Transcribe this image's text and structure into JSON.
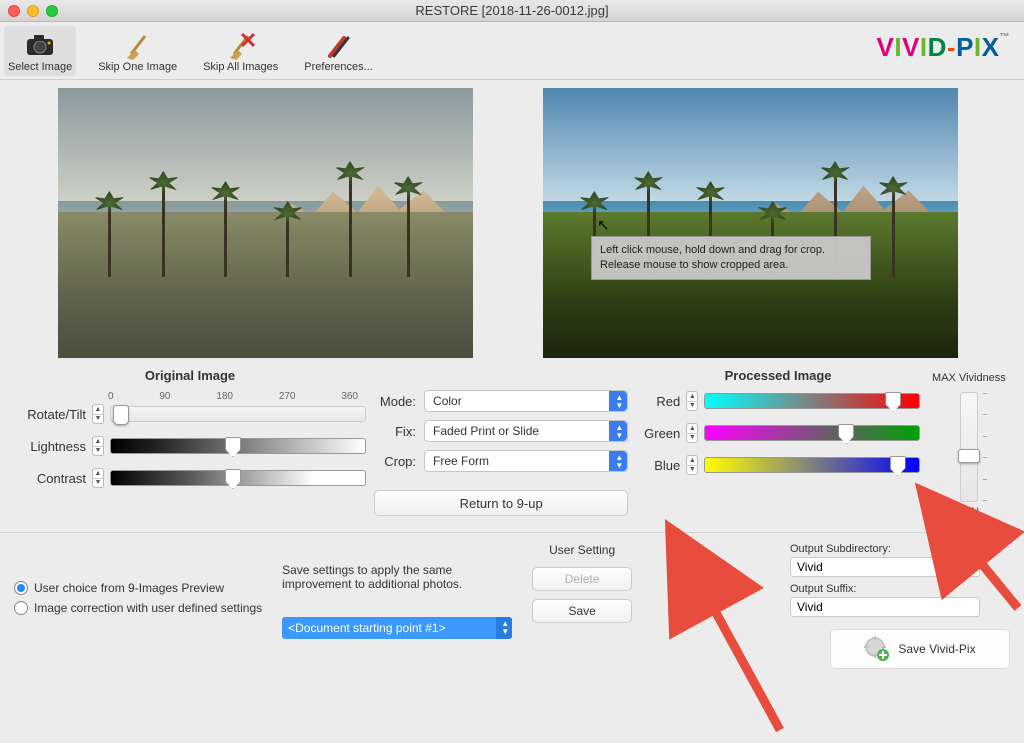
{
  "window_title": "RESTORE [2018-11-26-0012.jpg]",
  "toolbar": {
    "select": "Select Image",
    "skip_one": "Skip One Image",
    "skip_all": "Skip All Images",
    "prefs": "Preferences..."
  },
  "logo": {
    "text": "VIVID-PIX"
  },
  "tooltip": "Left click mouse, hold down and drag for crop. Release mouse to show cropped area.",
  "left": {
    "title": "Original Image",
    "rotate_label": "Rotate/Tilt",
    "rotate_ticks": [
      "0",
      "90",
      "180",
      "270",
      "360"
    ],
    "lightness_label": "Lightness",
    "contrast_label": "Contrast",
    "rotate_value_pct": 4,
    "lightness_value_pct": 48,
    "contrast_value_pct": 48
  },
  "center": {
    "mode_label": "Mode:",
    "mode_value": "Color",
    "fix_label": "Fix:",
    "fix_value": "Faded Print or Slide",
    "crop_label": "Crop:",
    "crop_value": "Free Form",
    "return_btn": "Return to 9-up"
  },
  "right": {
    "title": "Processed Image",
    "red_label": "Red",
    "green_label": "Green",
    "blue_label": "Blue",
    "red_value_pct": 88,
    "green_value_pct": 66,
    "blue_value_pct": 90
  },
  "vividness": {
    "max_label": "MAX Vividness",
    "min_label": "MIN",
    "value_pct": 58
  },
  "bottom": {
    "radio1": "User choice from 9-Images Preview",
    "radio2": "Image correction with user defined settings",
    "save_settings_text": "Save settings to apply the same improvement to additional photos.",
    "doc_select": "<Document starting point #1>",
    "user_setting_title": "User Setting",
    "delete_btn": "Delete",
    "save_btn": "Save",
    "out_subdir_label": "Output Subdirectory:",
    "out_subdir_value": "Vivid",
    "out_suffix_label": "Output Suffix:",
    "out_suffix_value": "Vivid",
    "save_pix_btn": "Save Vivid-Pix"
  }
}
